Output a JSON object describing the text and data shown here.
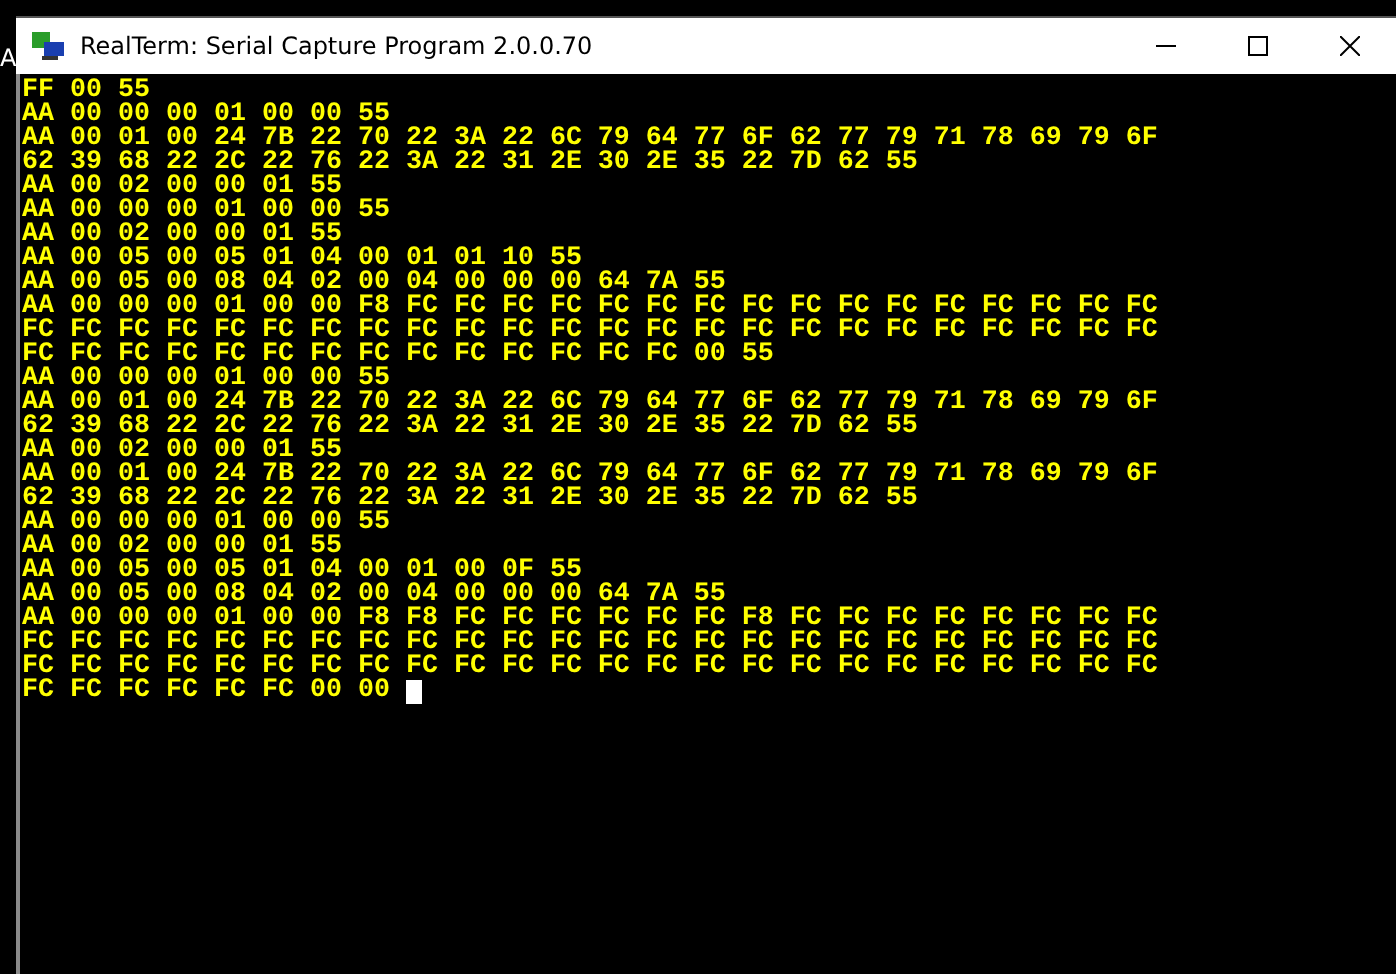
{
  "desktop": {
    "behind_text": "A"
  },
  "window": {
    "title": "RealTerm: Serial Capture Program 2.0.0.70"
  },
  "terminal": {
    "cursor": true,
    "lines": [
      "FF 00 55",
      "AA 00 00 00 01 00 00 55",
      "AA 00 01 00 24 7B 22 70 22 3A 22 6C 79 64 77 6F 62 77 79 71 78 69 79 6F",
      "62 39 68 22 2C 22 76 22 3A 22 31 2E 30 2E 35 22 7D 62 55",
      "AA 00 02 00 00 01 55",
      "AA 00 00 00 01 00 00 55",
      "AA 00 02 00 00 01 55",
      "AA 00 05 00 05 01 04 00 01 01 10 55",
      "AA 00 05 00 08 04 02 00 04 00 00 00 64 7A 55",
      "AA 00 00 00 01 00 00 F8 FC FC FC FC FC FC FC FC FC FC FC FC FC FC FC FC",
      "FC FC FC FC FC FC FC FC FC FC FC FC FC FC FC FC FC FC FC FC FC FC FC FC",
      "FC FC FC FC FC FC FC FC FC FC FC FC FC FC 00 55",
      "AA 00 00 00 01 00 00 55",
      "AA 00 01 00 24 7B 22 70 22 3A 22 6C 79 64 77 6F 62 77 79 71 78 69 79 6F",
      "62 39 68 22 2C 22 76 22 3A 22 31 2E 30 2E 35 22 7D 62 55",
      "AA 00 02 00 00 01 55",
      "AA 00 01 00 24 7B 22 70 22 3A 22 6C 79 64 77 6F 62 77 79 71 78 69 79 6F",
      "62 39 68 22 2C 22 76 22 3A 22 31 2E 30 2E 35 22 7D 62 55",
      "AA 00 00 00 01 00 00 55",
      "AA 00 02 00 00 01 55",
      "AA 00 05 00 05 01 04 00 01 00 0F 55",
      "AA 00 05 00 08 04 02 00 04 00 00 00 64 7A 55",
      "AA 00 00 00 01 00 00 F8 F8 FC FC FC FC FC FC F8 FC FC FC FC FC FC FC FC",
      "FC FC FC FC FC FC FC FC FC FC FC FC FC FC FC FC FC FC FC FC FC FC FC FC",
      "FC FC FC FC FC FC FC FC FC FC FC FC FC FC FC FC FC FC FC FC FC FC FC FC",
      "FC FC FC FC FC FC 00 00"
    ]
  }
}
